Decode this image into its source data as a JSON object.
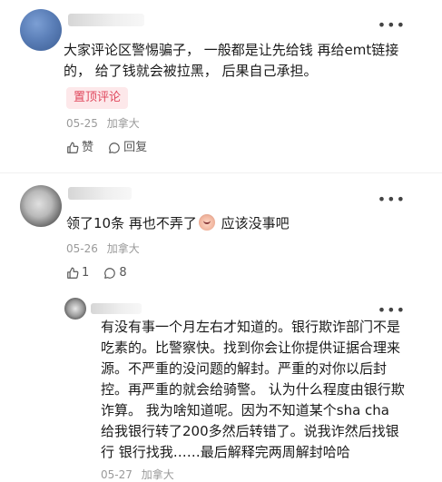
{
  "comments": [
    {
      "text": "大家评论区警惕骗子， 一般都是让先给钱 再给emt链接的， 给了钱就会被拉黑， 后果自己承担。",
      "badge": "置顶评论",
      "date": "05-25",
      "location": "加拿大",
      "like_label": "赞",
      "reply_label": "回复"
    },
    {
      "text_before_emoji": "领了10条 再也不弄了",
      "text_after_emoji": " 应该没事吧",
      "date": "05-26",
      "location": "加拿大",
      "like_count": "1",
      "reply_count": "8"
    },
    {
      "text": "有没有事一个月左右才知道的。银行欺诈部门不是吃素的。比警察快。找到你会让你提供证据合理来源。不严重的没问题的解封。严重的对你以后封控。再严重的就会给骑警。 认为什么程度由银行欺诈算。 我为啥知道呢。因为不知道某个sha cha 给我银行转了200多然后转错了。说我诈然后找银行 银行找我……最后解释完两周解封哈哈",
      "date": "05-27",
      "location": "加拿大"
    }
  ],
  "icons": {
    "more": "more-dots-icon",
    "like": "thumbs-up-icon",
    "reply": "comment-bubble-icon",
    "emoji": "emoji-face-icon"
  },
  "colors": {
    "badge_bg": "#fde8ea",
    "badge_text": "#e0485d",
    "meta": "#9a9a9a"
  }
}
